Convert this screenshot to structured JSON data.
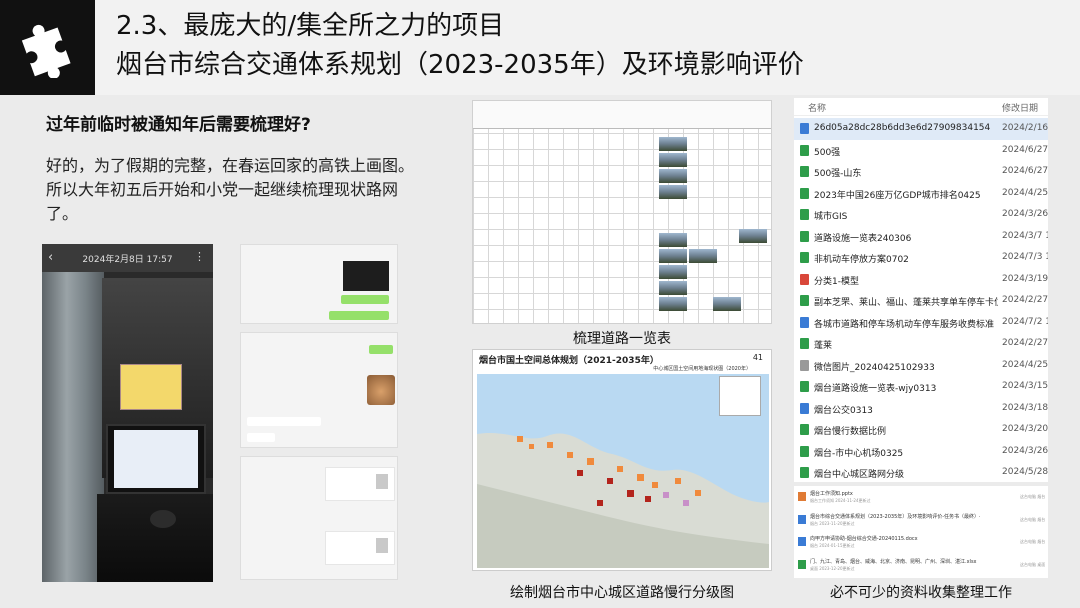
{
  "header": {
    "title_line1": "2.3、最庞大的/集全所之力的项目",
    "title_line2": "烟台市综合交通体系规划（2023-2035年）及环境影响评价",
    "logo_icon": "puzzle-icon"
  },
  "left": {
    "question": "过年前临时被通知年后需要梳理好?",
    "answer": "好的，为了假期的完整，在春运回家的高铁上画图。所以大年初五后开始和小党一起继续梳理现状路网了。"
  },
  "photo": {
    "date": "2024年2月8日 17:57"
  },
  "captions": {
    "table": "梳理道路一览表",
    "map": "绘制烟台市中心城区道路慢行分级图",
    "files": "必不可少的资料收集整理工作"
  },
  "map": {
    "title": "烟台市国土空间总体规划（2021-2035年）",
    "page": "41",
    "subtitle": "中心城区国土空间用地海现状图（2020年）"
  },
  "file_list": {
    "col_name": "名称",
    "col_date": "修改日期",
    "rows": [
      {
        "name": "26d05a28dc28b6dd3e6d27909834154",
        "date": "2024/2/16 2",
        "color": "#3a7bd5",
        "sel": true
      },
      {
        "name": "500强",
        "date": "2024/6/27",
        "color": "#2e9d4a"
      },
      {
        "name": "500强-山东",
        "date": "2024/6/27",
        "color": "#2e9d4a"
      },
      {
        "name": "2023年中国26座万亿GDP城市排名0425",
        "date": "2024/4/25",
        "color": "#2e9d4a"
      },
      {
        "name": "城市GIS",
        "date": "2024/3/26",
        "color": "#2e9d4a"
      },
      {
        "name": "道路设施一览表240306",
        "date": "2024/3/7 1",
        "color": "#2e9d4a"
      },
      {
        "name": "非机动车停放方案0702",
        "date": "2024/7/3 1",
        "color": "#2e9d4a"
      },
      {
        "name": "分类1-模型",
        "date": "2024/3/19",
        "color": "#d9473a"
      },
      {
        "name": "副本芝罘、莱山、福山、蓬莱共享单车停车卡位…",
        "date": "2024/2/27",
        "color": "#2e9d4a"
      },
      {
        "name": "各城市道路和停车场机动车停车服务收费标准",
        "date": "2024/7/2 1",
        "color": "#3a7bd5"
      },
      {
        "name": "蓬莱",
        "date": "2024/2/27",
        "color": "#2e9d4a"
      },
      {
        "name": "微信图片_20240425102933",
        "date": "2024/4/25",
        "color": "#999999"
      },
      {
        "name": "烟台道路设施一览表-wjy0313",
        "date": "2024/3/15",
        "color": "#2e9d4a"
      },
      {
        "name": "烟台公交0313",
        "date": "2024/3/18 2",
        "color": "#3a7bd5"
      },
      {
        "name": "烟台慢行数据比例",
        "date": "2024/3/20",
        "color": "#2e9d4a"
      },
      {
        "name": "烟台-市中心机场0325",
        "date": "2024/3/26",
        "color": "#2e9d4a"
      },
      {
        "name": "烟台中心城区路网分级",
        "date": "2024/5/28",
        "color": "#2e9d4a"
      }
    ]
  },
  "search_results": [
    {
      "name": "烟台工作须知.pptx",
      "meta": "烟台工作须知 2024-11-24更新过",
      "src": "这台电脑 烟台",
      "color": "#e07b35"
    },
    {
      "name": "烟台市综合交通体系规划（2023-2035年）及环境影响评价-任务书（最终）-11.08-中规院-修改",
      "meta": "烟台 2023-11-20更新过",
      "src": "这台电脑 烟台",
      "color": "#3a7bd5"
    },
    {
      "name": "向甲方申请协助-烟台综合交通-20240115.docx",
      "meta": "烟台 2024-01-15更新过",
      "src": "这台电脑 烟台",
      "color": "#3a7bd5"
    },
    {
      "name": "门、九江、青岛、烟台、威海、北京、济南、昆明、广州、深圳、湛江.xlsx",
      "meta": "桌面 2023-12-20更新过",
      "src": "这台电脑 桌面",
      "color": "#2e9d4a"
    }
  ],
  "colors": {
    "header_bg": "#f2f2f2",
    "page_bg": "#ebebeb",
    "logo_bg": "#111111"
  }
}
